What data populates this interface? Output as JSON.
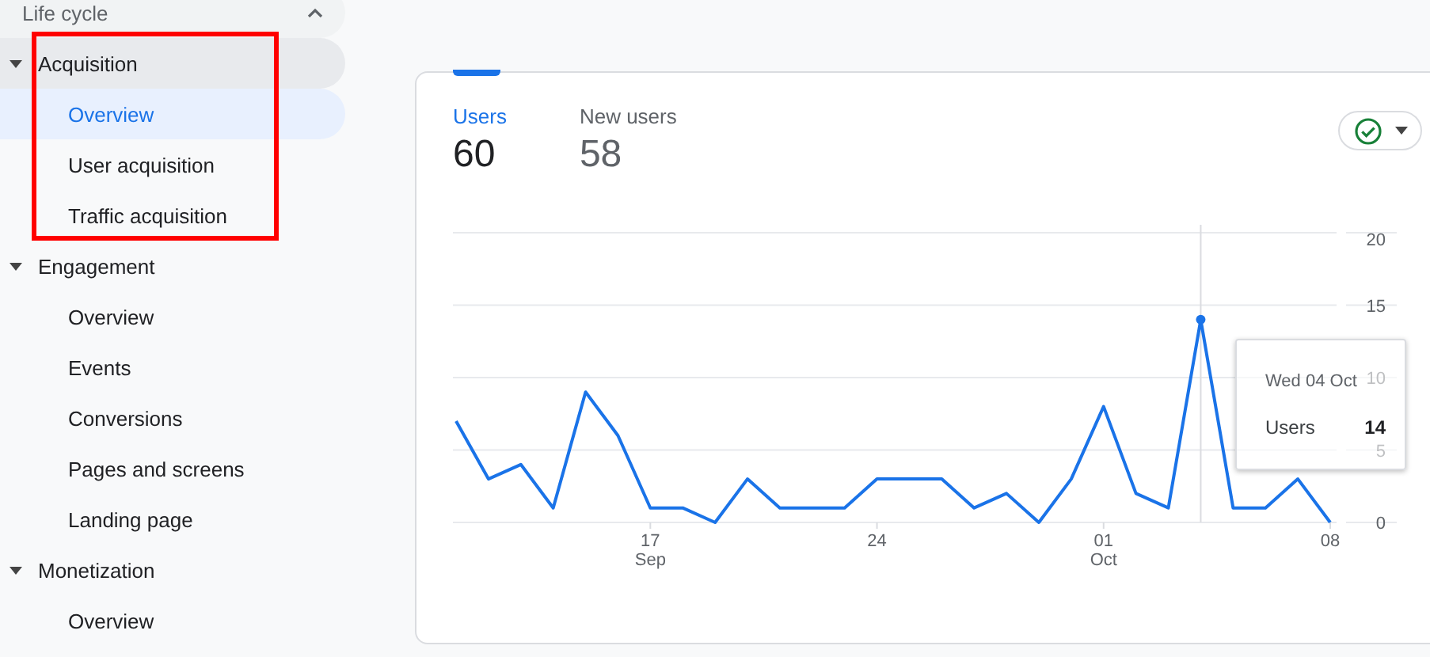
{
  "sidebar": {
    "header": {
      "label": "Life cycle",
      "expanded": true
    },
    "sections": [
      {
        "label": "Acquisition",
        "expanded": true,
        "highlighted": true,
        "active": true,
        "children": [
          {
            "label": "Overview",
            "selected": true
          },
          {
            "label": "User acquisition",
            "selected": false
          },
          {
            "label": "Traffic acquisition",
            "selected": false
          }
        ]
      },
      {
        "label": "Engagement",
        "expanded": true,
        "highlighted": false,
        "active": false,
        "children": [
          {
            "label": "Overview",
            "selected": false
          },
          {
            "label": "Events",
            "selected": false
          },
          {
            "label": "Conversions",
            "selected": false
          },
          {
            "label": "Pages and screens",
            "selected": false
          },
          {
            "label": "Landing page",
            "selected": false
          }
        ]
      },
      {
        "label": "Monetization",
        "expanded": true,
        "highlighted": false,
        "active": false,
        "children": [
          {
            "label": "Overview",
            "selected": false
          }
        ]
      }
    ]
  },
  "card": {
    "metrics": [
      {
        "label": "Users",
        "value": "60",
        "selected": true
      },
      {
        "label": "New users",
        "value": "58",
        "selected": false
      }
    ],
    "compare_button": {
      "checked": true
    },
    "chart": {
      "chart_data": {
        "type": "line",
        "categories": [
          null,
          null,
          null,
          null,
          null,
          null,
          "17 Sep",
          null,
          null,
          null,
          null,
          null,
          null,
          "24",
          null,
          null,
          null,
          null,
          null,
          null,
          "01 Oct",
          null,
          null,
          null,
          null,
          null,
          null,
          "08"
        ],
        "series": [
          {
            "name": "Users",
            "color": "#1a73e8",
            "values": [
              7,
              3,
              4,
              1,
              9,
              6,
              1,
              1,
              0,
              3,
              1,
              1,
              1,
              3,
              3,
              3,
              1,
              2,
              0,
              3,
              8,
              2,
              1,
              14,
              1,
              1,
              3,
              0
            ]
          }
        ],
        "ylim": [
          0,
          20
        ],
        "yticks": [
          0,
          5,
          10,
          15,
          20
        ],
        "grid": true
      },
      "tooltip": {
        "date": "Wed 04 Oct",
        "value": "14"
      }
    }
  }
}
